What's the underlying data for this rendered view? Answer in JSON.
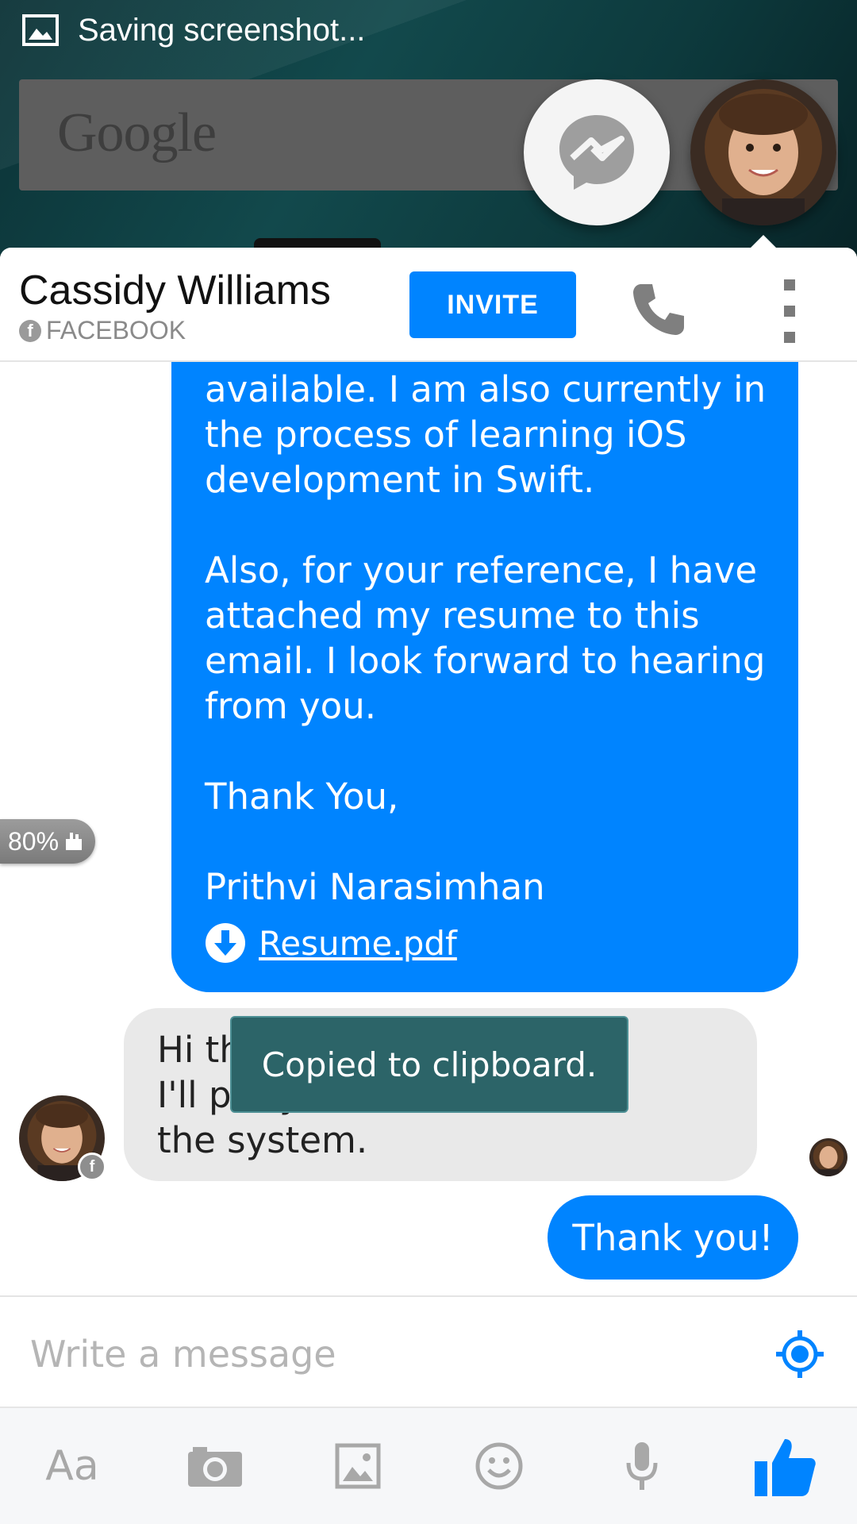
{
  "status_bar": {
    "notification_text": "Saving screenshot..."
  },
  "home_screen": {
    "search_logo": "Google"
  },
  "chat_head": {
    "icon": "messenger-icon"
  },
  "header": {
    "contact_name": "Cassidy Williams",
    "source": "FACEBOOK",
    "invite_label": "INVITE"
  },
  "messages": {
    "outgoing_long": "available. I am also currently in\nthe process of learning iOS\ndevelopment in Swift.\n\nAlso, for your reference, I have\nattached my resume to this\nemail. I look forward to hearing\nfrom you.\n\nThank You,\n\nPrithvi Narasimhan",
    "attachment_name": "Resume.pdf",
    "incoming": "Hi there!\nI'll put your resume in\nthe system.",
    "outgoing_reply": "Thank you!"
  },
  "battery_indicator": {
    "label": "80%"
  },
  "composer": {
    "placeholder": "Write a message"
  },
  "toast": {
    "text": "Copied to clipboard."
  },
  "toolbar": {
    "text_label": "Aa",
    "icons": [
      "text-format-icon",
      "camera-icon",
      "gallery-icon",
      "emoji-icon",
      "microphone-icon",
      "like-icon"
    ]
  },
  "colors": {
    "accent": "#0084ff",
    "incoming_bubble": "#e9e9e9",
    "toast": "#2c6468"
  }
}
